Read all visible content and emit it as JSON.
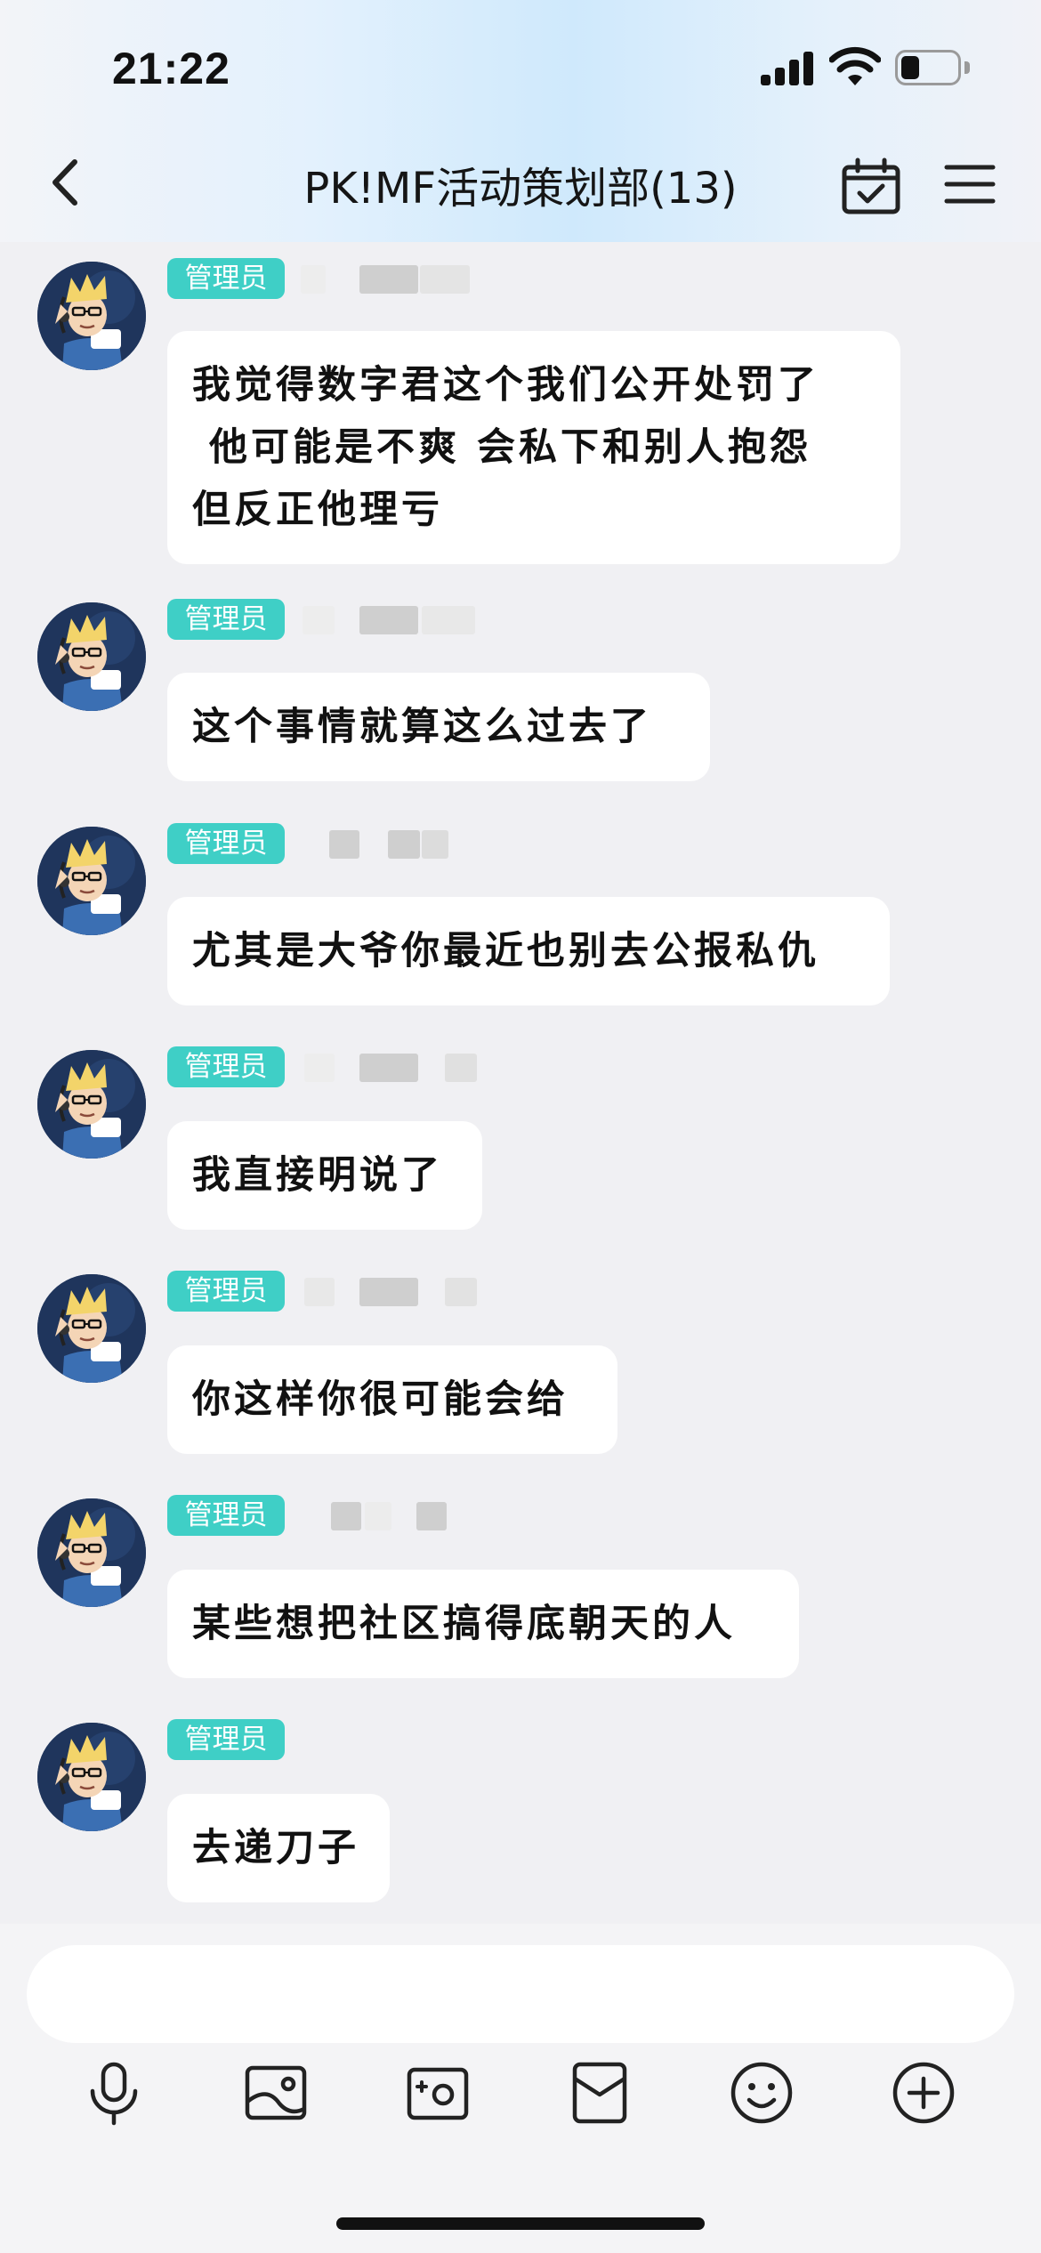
{
  "status_bar": {
    "time": "21:22",
    "battery_level": 0.25
  },
  "header": {
    "title": "PK!MF活动策划部(13)"
  },
  "messages": [
    {
      "badge": "管理员",
      "text_lines": [
        "我觉得数字君这个我们公开处罚了",
        " 他可能是不爽 会私下和别人抱怨",
        "但反正他理亏"
      ]
    },
    {
      "badge": "管理员",
      "text_lines": [
        "这个事情就算这么过去了"
      ]
    },
    {
      "badge": "管理员",
      "text_lines": [
        "尤其是大爷你最近也别去公报私仇"
      ]
    },
    {
      "badge": "管理员",
      "text_lines": [
        "我直接明说了"
      ]
    },
    {
      "badge": "管理员",
      "text_lines": [
        "你这样你很可能会给"
      ]
    },
    {
      "badge": "管理员",
      "text_lines": [
        "某些想把社区搞得底朝天的人"
      ]
    },
    {
      "badge": "管理员",
      "text_lines": [
        "去递刀子"
      ]
    }
  ],
  "input": {
    "value": "",
    "placeholder": ""
  },
  "toolbar": [
    "microphone-icon",
    "image-icon",
    "camera-icon",
    "red-packet-icon",
    "emoji-icon",
    "plus-icon"
  ],
  "colors": {
    "badge": "#3fcfc6",
    "background": "#f0f0f3",
    "bubble": "#ffffff"
  }
}
